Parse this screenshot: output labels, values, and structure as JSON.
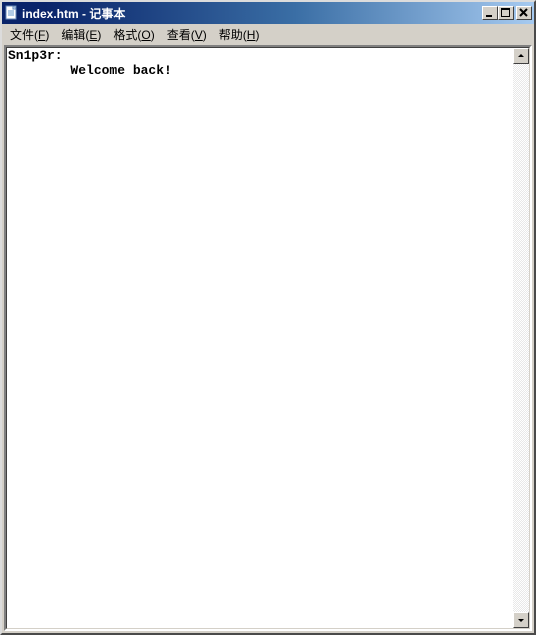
{
  "titlebar": {
    "title": "index.htm - 记事本",
    "app_icon_name": "notepad-icon"
  },
  "window_buttons": {
    "minimize": "Minimize",
    "maximize": "Maximize",
    "close": "Close"
  },
  "menu": {
    "file": {
      "label": "文件",
      "accel": "F"
    },
    "edit": {
      "label": "编辑",
      "accel": "E"
    },
    "format": {
      "label": "格式",
      "accel": "O"
    },
    "view": {
      "label": "查看",
      "accel": "V"
    },
    "help": {
      "label": "帮助",
      "accel": "H"
    }
  },
  "editor": {
    "text": "Sn1p3r:\n        Welcome back!"
  },
  "scrollbar": {
    "up": "scroll-up",
    "down": "scroll-down"
  },
  "colors": {
    "titlebar_start": "#0a246a",
    "titlebar_end": "#a6caf0",
    "face": "#d4d0c8",
    "text_bg": "#ffffff"
  }
}
